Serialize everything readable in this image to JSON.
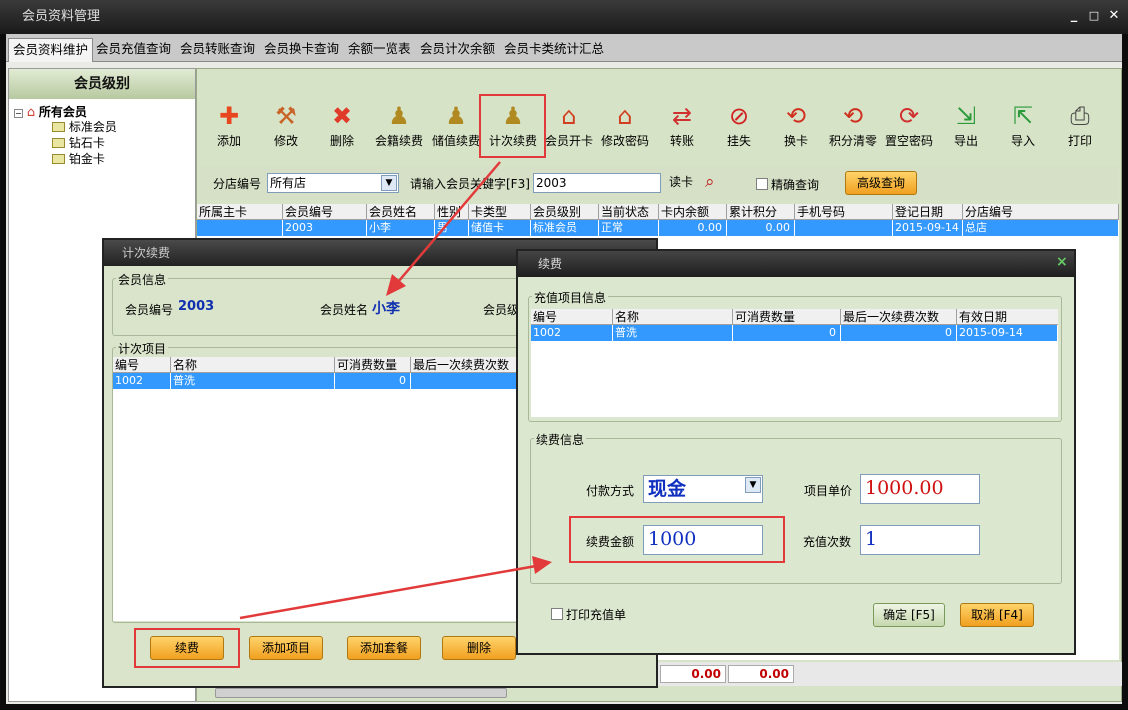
{
  "window": {
    "title": "会员资料管理",
    "min": "_",
    "max": "□",
    "close": "✕"
  },
  "tabs": [
    "会员资料维护",
    "会员充值查询",
    "会员转账查询",
    "会员换卡查询",
    "余额一览表",
    "会员计次余额",
    "会员卡类统计汇总"
  ],
  "sidebar": {
    "header": "会员级别",
    "root": "所有会员",
    "items": [
      "标准会员",
      "钻石卡",
      "铂金卡"
    ]
  },
  "toolbar": [
    {
      "label": "添加",
      "icon": "plus-icon",
      "glyph": "✚",
      "color": "#e8461e"
    },
    {
      "label": "修改",
      "icon": "wrench-icon",
      "glyph": "🔧",
      "color": "#c86428"
    },
    {
      "label": "删除",
      "icon": "delete-x-icon",
      "glyph": "✖",
      "color": "#e03a2a"
    },
    {
      "label": "会籍续费",
      "icon": "pawn-icon",
      "glyph": "♟",
      "color": "#b08a20"
    },
    {
      "label": "储值续费",
      "icon": "pawn-icon",
      "glyph": "♟",
      "color": "#b08a20"
    },
    {
      "label": "计次续费",
      "icon": "pawn-icon",
      "glyph": "♟",
      "color": "#b08a20"
    },
    {
      "label": "会员开卡",
      "icon": "house-icon",
      "glyph": "⌂",
      "color": "#d04020"
    },
    {
      "label": "修改密码",
      "icon": "house-icon",
      "glyph": "⌂",
      "color": "#d04020"
    },
    {
      "label": "转账",
      "icon": "transfer-icon",
      "glyph": "⇄",
      "color": "#d03030"
    },
    {
      "label": "挂失",
      "icon": "forbidden-icon",
      "glyph": "⊘",
      "color": "#d02020"
    },
    {
      "label": "换卡",
      "icon": "exchange-icon",
      "glyph": "⟲",
      "color": "#d03020"
    },
    {
      "label": "积分清零",
      "icon": "reset-icon",
      "glyph": "⟲",
      "color": "#d03020"
    },
    {
      "label": "置空密码",
      "icon": "refresh-icon",
      "glyph": "⟳",
      "color": "#d03030"
    },
    {
      "label": "导出",
      "icon": "export-icon",
      "glyph": "⇲",
      "color": "#2a9a3a"
    },
    {
      "label": "导入",
      "icon": "import-icon",
      "glyph": "⇱",
      "color": "#2a9a3a"
    },
    {
      "label": "打印",
      "icon": "printer-icon",
      "glyph": "⎙",
      "color": "#444444"
    }
  ],
  "filter": {
    "branch_label": "分店编号",
    "branch_value": "所有店",
    "keyword_label": "请输入会员关键字[F3]",
    "keyword_value": "2003",
    "read_card": "读卡",
    "exact_label": "精确查询",
    "advanced": "高级查询"
  },
  "grid": {
    "headers": [
      "所属主卡",
      "会员编号",
      "会员姓名",
      "性别",
      "卡类型",
      "会员级别",
      "当前状态",
      "卡内余额",
      "累计积分",
      "手机号码",
      "登记日期",
      "分店编号"
    ],
    "row": [
      "",
      "2003",
      "小李",
      "男",
      "储值卡",
      "标准会员",
      "正常",
      "0.00",
      "0.00",
      "",
      "2015-09-14",
      "总店"
    ]
  },
  "status": {
    "v1": "0.00",
    "v2": "0.00"
  },
  "dialog1": {
    "title": "计次续费",
    "member_group": "会员信息",
    "id_label": "会员编号",
    "id_value": "2003",
    "name_label": "会员姓名",
    "name_value": "小李",
    "level_label": "会员级",
    "items_group": "计次项目",
    "headers": [
      "编号",
      "名称",
      "可消费数量",
      "最后一次续费次数"
    ],
    "row": [
      "1002",
      "普洗",
      "0",
      ""
    ],
    "buttons": [
      "续费",
      "添加项目",
      "添加套餐",
      "删除"
    ]
  },
  "dialog2": {
    "title": "续费",
    "close": "×",
    "items_group": "充值项目信息",
    "headers": [
      "编号",
      "名称",
      "可消费数量",
      "最后一次续费次数",
      "有效日期"
    ],
    "row": [
      "1002",
      "普洗",
      "0",
      "0",
      "2015-09-14"
    ],
    "renew_group": "续费信息",
    "pay_label": "付款方式",
    "pay_value": "现金",
    "price_label": "项目单价",
    "price_value": "1000.00",
    "amount_label": "续费金额",
    "amount_value": "1000",
    "count_label": "充值次数",
    "count_value": "1",
    "print_label": "打印充值单",
    "ok": "确定 [F5]",
    "cancel": "取消 [F4]"
  }
}
